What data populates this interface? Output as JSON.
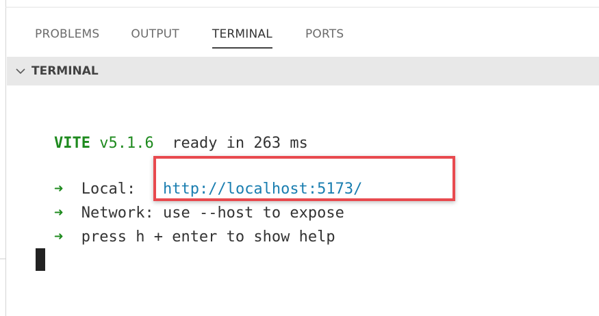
{
  "panel": {
    "tabs": [
      {
        "label": "PROBLEMS",
        "active": false
      },
      {
        "label": "OUTPUT",
        "active": false
      },
      {
        "label": "TERMINAL",
        "active": true
      },
      {
        "label": "PORTS",
        "active": false
      }
    ],
    "section_title": "TERMINAL"
  },
  "terminal": {
    "vite_name": "VITE",
    "vite_version": "v5.1.6",
    "ready_text": "  ready in 263 ms",
    "arrow": "➜",
    "local_label": "Local:",
    "local_url": "http://localhost:5173/",
    "network_label": "Network:",
    "network_text": "use --host to expose",
    "help_text": "press h + enter to show help"
  },
  "colors": {
    "vite_green": "#1e8a1e",
    "link_blue": "#1a7eb0",
    "highlight_red": "#e84a4f",
    "header_bg": "#e8e8e8"
  }
}
